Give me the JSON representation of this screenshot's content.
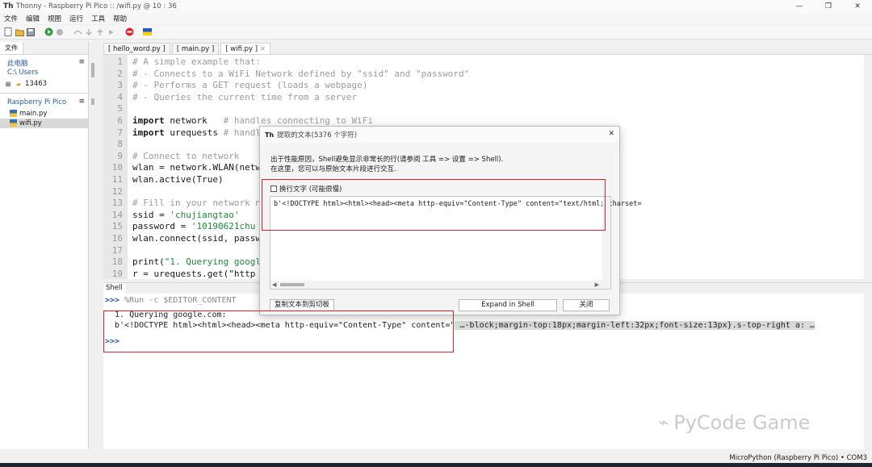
{
  "window": {
    "title": "Thonny  -  Raspberry Pi Pico :: /wifi.py  @  10 : 36",
    "controls": [
      "—",
      "❐",
      "✕"
    ]
  },
  "menu": [
    "文件",
    "编辑",
    "视图",
    "运行",
    "工具",
    "帮助"
  ],
  "files_panel": {
    "tab": "文件",
    "local_title": "此电脑",
    "local_path": "C:\\ Users",
    "local_item": "13463",
    "device_title": "Raspberry Pi Pico",
    "device_files": [
      "main.py",
      "wifi.py"
    ]
  },
  "editor": {
    "tabs": [
      "[ hello_word.py ]",
      "[ main.py ]",
      "[ wifi.py ]"
    ],
    "lines": [
      {
        "n": "1",
        "text": "# A simple example that:"
      },
      {
        "n": "2",
        "text": "# - Connects to a WiFi Network defined by \"ssid\" and \"password\""
      },
      {
        "n": "3",
        "text": "# - Performs a GET request (loads a webpage)"
      },
      {
        "n": "4",
        "text": "# - Queries the current time from a server"
      },
      {
        "n": "5",
        "text": ""
      },
      {
        "n": "6",
        "kw": "import",
        "rest": " network",
        "comment": "   # handles connecting to WiFi"
      },
      {
        "n": "7",
        "kw": "import",
        "rest": " urequests",
        "comment": " # handl"
      },
      {
        "n": "8",
        "text": ""
      },
      {
        "n": "9",
        "text": "# Connect to network"
      },
      {
        "n": "10",
        "code": "wlan = network.WLAN(netw"
      },
      {
        "n": "11",
        "code": "wlan.active(True)"
      },
      {
        "n": "12",
        "text": ""
      },
      {
        "n": "13",
        "text": "# Fill in your network n"
      },
      {
        "n": "14",
        "code_pre": "ssid = ",
        "str": "'chujiangtao'"
      },
      {
        "n": "15",
        "code_pre": "password = ",
        "str": "'10190621chu"
      },
      {
        "n": "16",
        "code": "wlan.connect(ssid, passw"
      },
      {
        "n": "17",
        "text": ""
      },
      {
        "n": "18",
        "code_pre": "print(",
        "str": "\"1. Querying googl"
      },
      {
        "n": "19",
        "code": "r = urequests.get(\"http"
      }
    ]
  },
  "shell": {
    "tab": "Shell",
    "prompt": ">>>",
    "command": " %Run -c $EDITOR_CONTENT",
    "output1": "  1. Querying google.com:",
    "output2_head": "  b'<!DOCTYPE html><html><head><meta http-equiv=\"Content-Type\" content=\"",
    "output2_ellipsis": " …",
    "output2_tail": "-block;margin-top:18px;margin-left:32px;font-size:13px}.s-top-right a: …",
    "prompt2": ">>>"
  },
  "status": {
    "interpreter": "MicroPython (Raspberry Pi Pico)  •  COM3"
  },
  "dialog": {
    "title": "提取的文本(5376 个字符)",
    "message1": "出于性能原因，Shell避免显示非常长的行(请参阅 工具 => 设置 => Shell).",
    "message2": "在这里，您可以与原始文本片段进行交互.",
    "wrap_label": "换行文字 (可能很慢)",
    "text_content": "b'<!DOCTYPE html><html><head><meta http-equiv=\"Content-Type\" content=\"text/html; charset=",
    "copy_button": "复制文本到剪切板",
    "expand_button": "Expand in Shell",
    "close_button": "关闭"
  },
  "watermark": "PyCode Game"
}
